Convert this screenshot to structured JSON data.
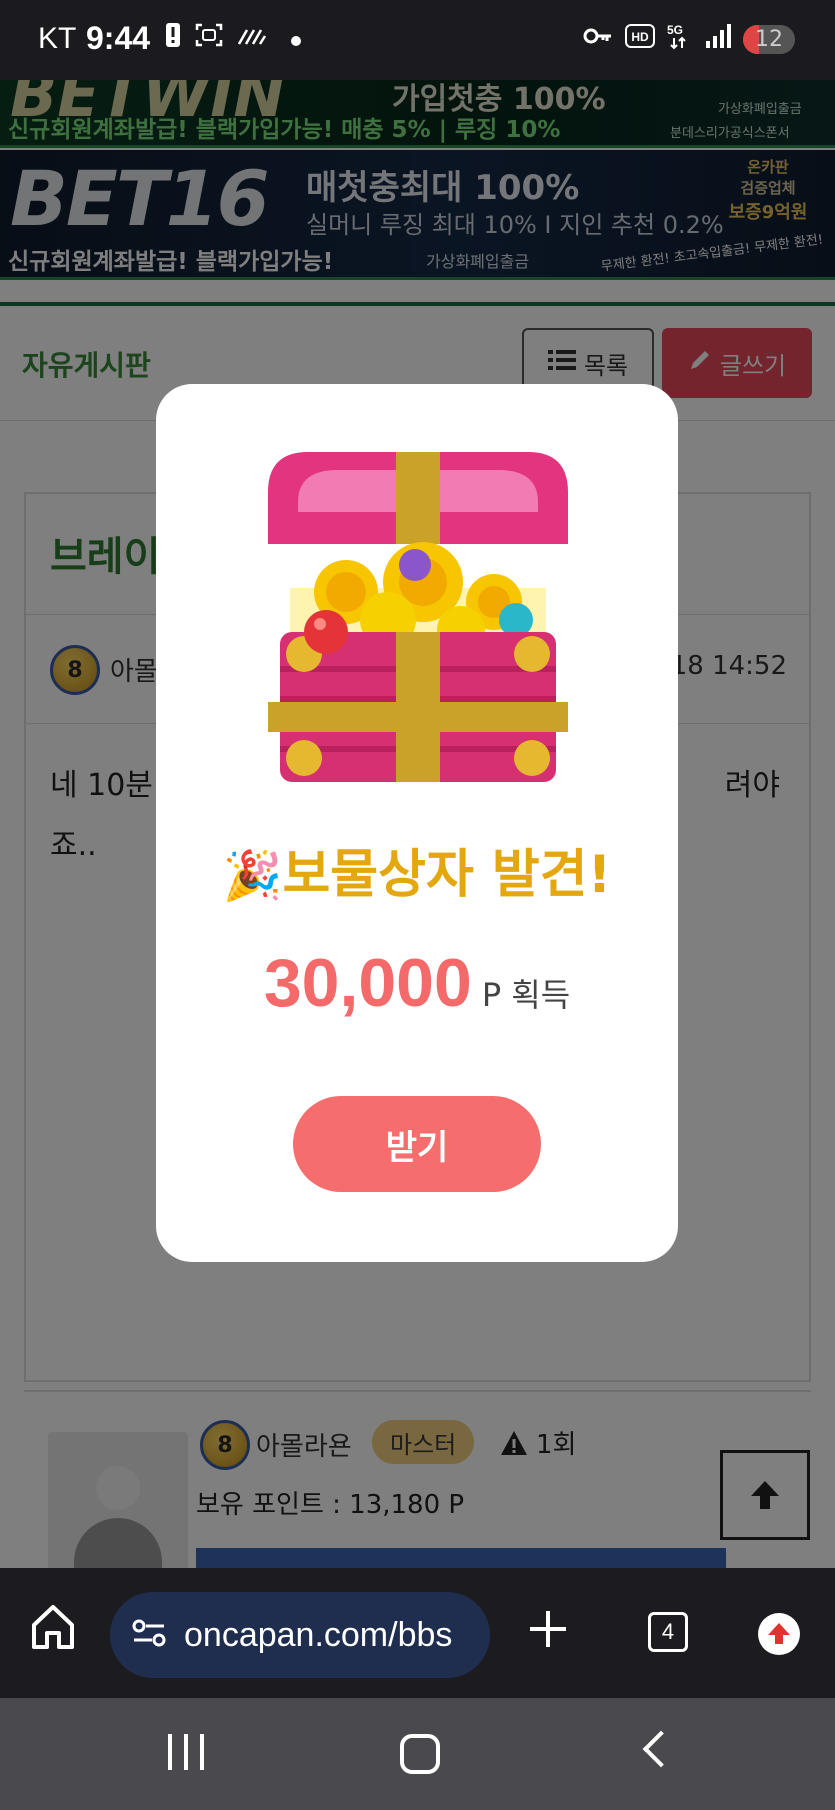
{
  "status_bar": {
    "carrier": "KT",
    "time": "9:44",
    "battery": "12",
    "network": "5G"
  },
  "banners": {
    "top_text_1": "가입첫충 100%",
    "top_text_2": "신규회원계좌발급! 블랙가입가능! 매충 5% | 루징 10%",
    "top_note_1": "가상화폐입출금",
    "top_note_2": "분데스리가공식스폰서",
    "logo": "BET16",
    "headline": "매첫충최대 100%",
    "subline": "실머니 루징 최대 10% I 지인 추천 0.2%",
    "bottom_line": "신규회원계좌발급! 블랙가입가능!",
    "bottom_note": "가상화폐입출금",
    "badge_1": "온카판",
    "badge_2": "검증업체",
    "badge_3": "보증9억원",
    "ticker": "무제한 환전! 초고속입출금! 무제한 환전!"
  },
  "board": {
    "title": "자유게시판",
    "list_button": "목록",
    "write_button": "글쓰기"
  },
  "post": {
    "title_fragment": "브레이",
    "level": "8",
    "author_fragment": "아몰",
    "date_fragment": "18 14:52",
    "body_line1_left": "네 10분",
    "body_line1_right": "려야",
    "body_line2": "죠.."
  },
  "author_box": {
    "level": "8",
    "name": "아몰라욘",
    "grade": "마스터",
    "warnings": "1회",
    "points_label": "보유 포인트 : 13,180 P"
  },
  "modal": {
    "title_emoji": "🎉",
    "title": "보물상자 발견!",
    "amount": "30,000",
    "unit": "P 획득",
    "claim_button": "받기"
  },
  "browser": {
    "url": "oncapan.com/bbs",
    "tab_count": "4"
  }
}
